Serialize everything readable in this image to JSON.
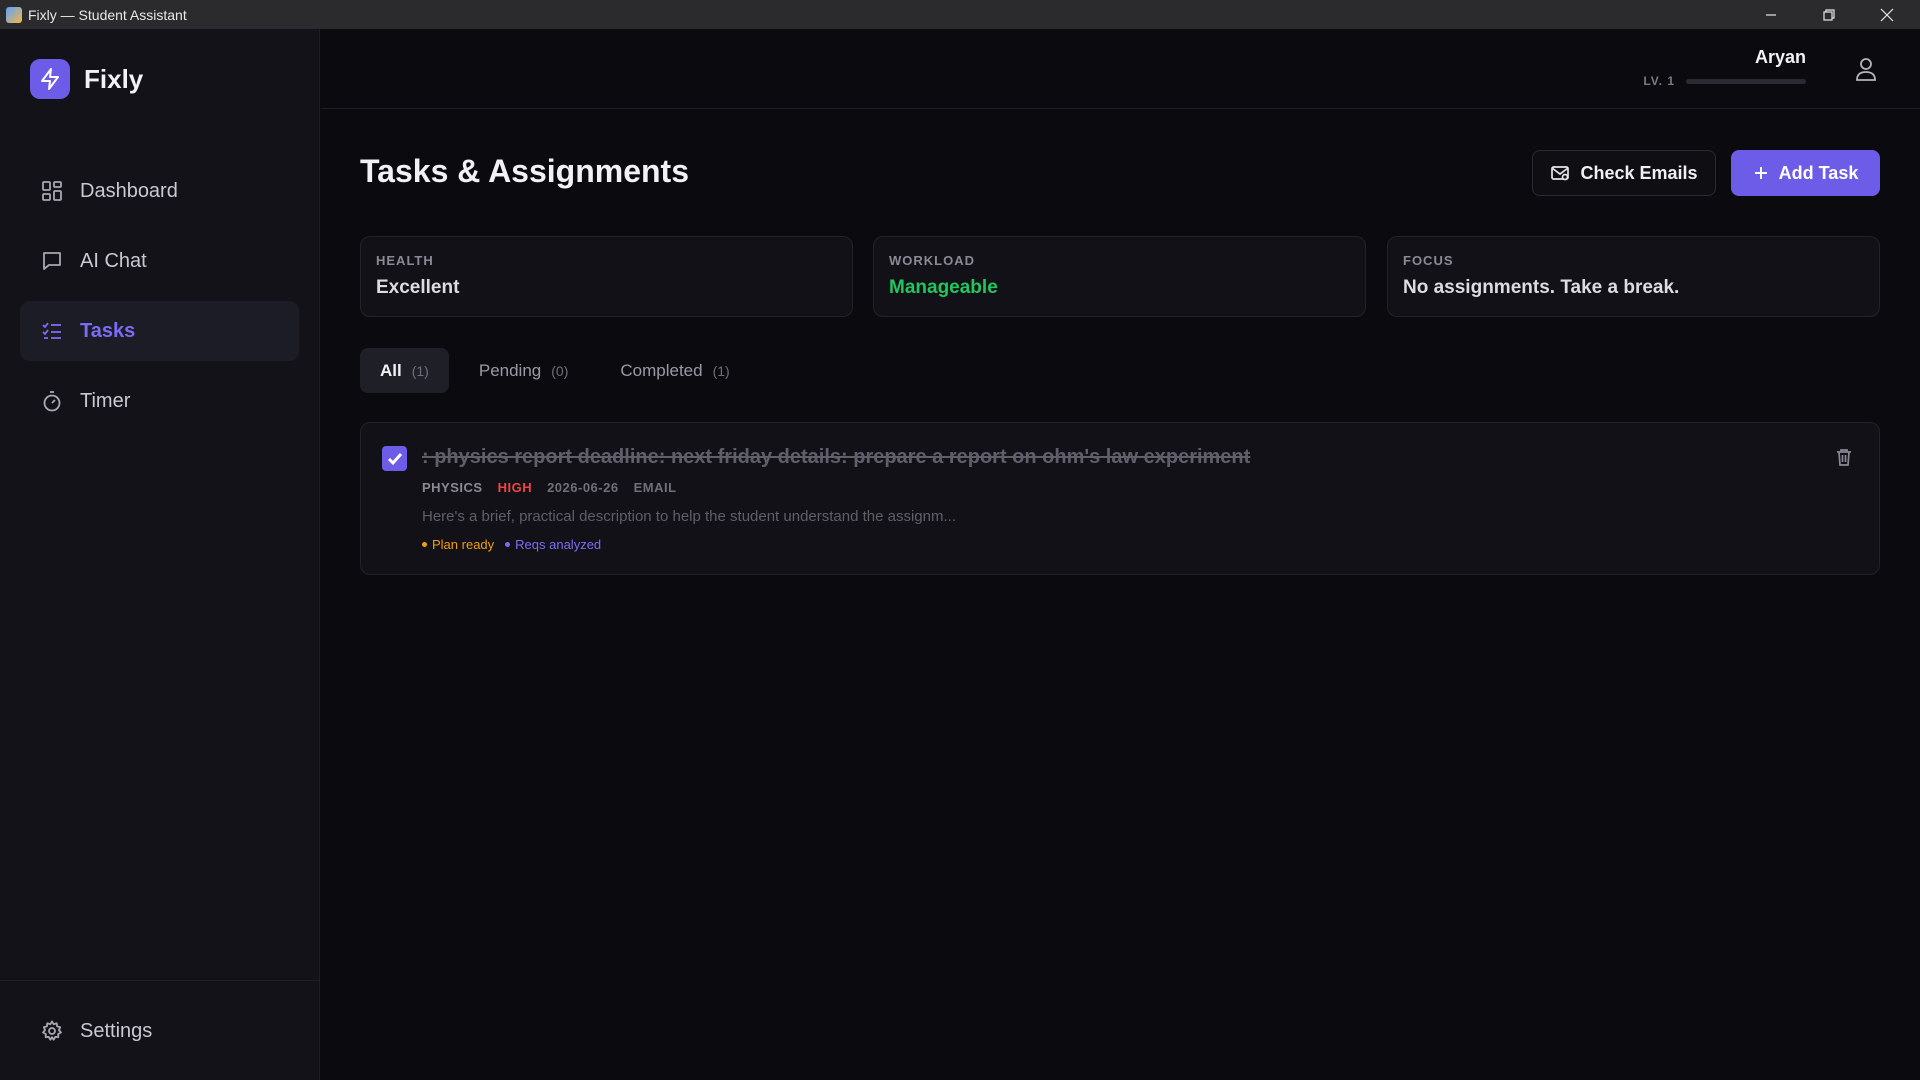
{
  "window": {
    "title": "Fixly — Student Assistant"
  },
  "sidebar": {
    "brand": "Fixly",
    "items": [
      {
        "label": "Dashboard",
        "icon": "dashboard-grid-icon"
      },
      {
        "label": "AI Chat",
        "icon": "chat-bubble-icon"
      },
      {
        "label": "Tasks",
        "icon": "tasks-list-icon",
        "active": true
      },
      {
        "label": "Timer",
        "icon": "stopwatch-icon"
      }
    ],
    "settings": "Settings"
  },
  "header": {
    "user_name": "Aryan",
    "level": "LV. 1",
    "xp_progress": 0
  },
  "page": {
    "title": "Tasks & Assignments",
    "check_emails": "Check Emails",
    "add_task": "Add Task"
  },
  "stats": [
    {
      "label": "HEALTH",
      "value": "Excellent"
    },
    {
      "label": "WORKLOAD",
      "value": "Manageable",
      "color": "#22c55e"
    },
    {
      "label": "FOCUS",
      "value": "No assignments. Take a break."
    }
  ],
  "tabs": [
    {
      "label": "All",
      "count": "(1)",
      "active": true
    },
    {
      "label": "Pending",
      "count": "(0)"
    },
    {
      "label": "Completed",
      "count": "(1)"
    }
  ],
  "tasks": [
    {
      "title": ": physics report deadline: next friday details: prepare a report on ohm's law experiment",
      "completed": true,
      "subject": "PHYSICS",
      "priority": "HIGH",
      "date": "2026-06-26",
      "source": "EMAIL",
      "description": "Here's a brief, practical description to help the student understand the assignm...",
      "tags": [
        "Plan ready",
        "Reqs analyzed"
      ]
    }
  ],
  "colors": {
    "accent": "#6c5ce7",
    "priority_high": "#ef4444",
    "workload_ok": "#22c55e",
    "tag_plan": "#f59e0b",
    "tag_reqs": "#7c6cf5"
  }
}
